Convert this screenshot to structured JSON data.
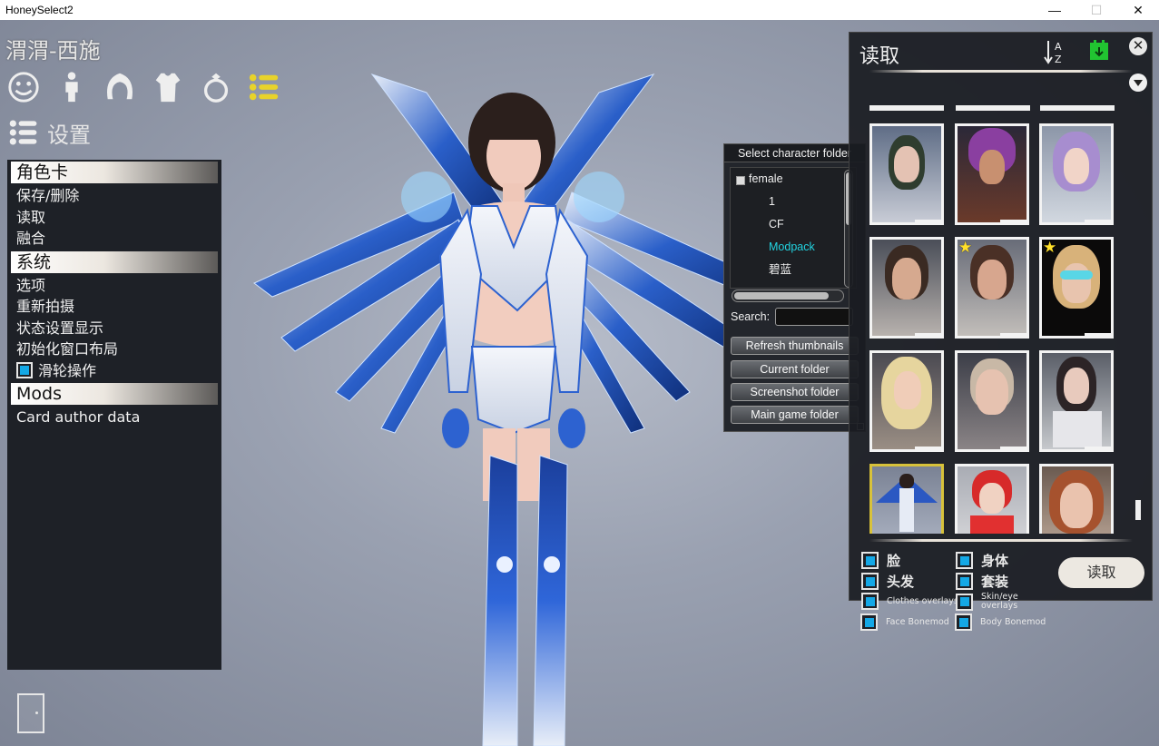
{
  "window": {
    "title": "HoneySelect2",
    "controls": {
      "minimize": "—",
      "maximize": "☐",
      "close": "✕"
    }
  },
  "character_name": "渭渭-西施",
  "tabs": [
    {
      "icon": "face-icon"
    },
    {
      "icon": "body-icon"
    },
    {
      "icon": "hair-icon"
    },
    {
      "icon": "clothes-icon"
    },
    {
      "icon": "accessory-icon"
    },
    {
      "icon": "list-icon",
      "active": true
    }
  ],
  "settings_label": "设置",
  "menu": {
    "section_card": "角色卡",
    "save_delete": "保存/删除",
    "load": "读取",
    "merge": "融合",
    "section_system": "系统",
    "options": "选项",
    "recapture": "重新拍摄",
    "status_display": "状态设置显示",
    "reset_layout": "初始化窗口布局",
    "wheel_operation": "滑轮操作",
    "section_mods": "Mods",
    "card_author": "Card author data"
  },
  "folder_panel": {
    "header": "Select character folder",
    "tree": {
      "root": "female",
      "children": [
        "1",
        "CF",
        "Modpack",
        "碧蓝"
      ],
      "selected": "Modpack"
    },
    "search_label": "Search:",
    "search_value": "",
    "buttons": {
      "refresh": "Refresh thumbnails",
      "current": "Current folder",
      "screenshot": "Screenshot folder",
      "main": "Main game folder"
    }
  },
  "load_panel": {
    "title": "读取",
    "sort_icon": "sort-az-icon",
    "date_icon": "calendar-icon",
    "close_symbol": "✕",
    "options": {
      "face": "脸",
      "body": "身体",
      "hair": "头发",
      "outfit": "套装",
      "clothes_overlays": "Clothes overlays",
      "skin_eye_overlays": "Skin/eye overlays",
      "face_bonemod": "Face Bonemod",
      "body_bonemod": "Body Bonemod"
    },
    "load_button": "读取",
    "colors": {
      "accent": "#14a8e6",
      "selected_frame": "#d8c23a",
      "star": "#ffe02a"
    }
  }
}
